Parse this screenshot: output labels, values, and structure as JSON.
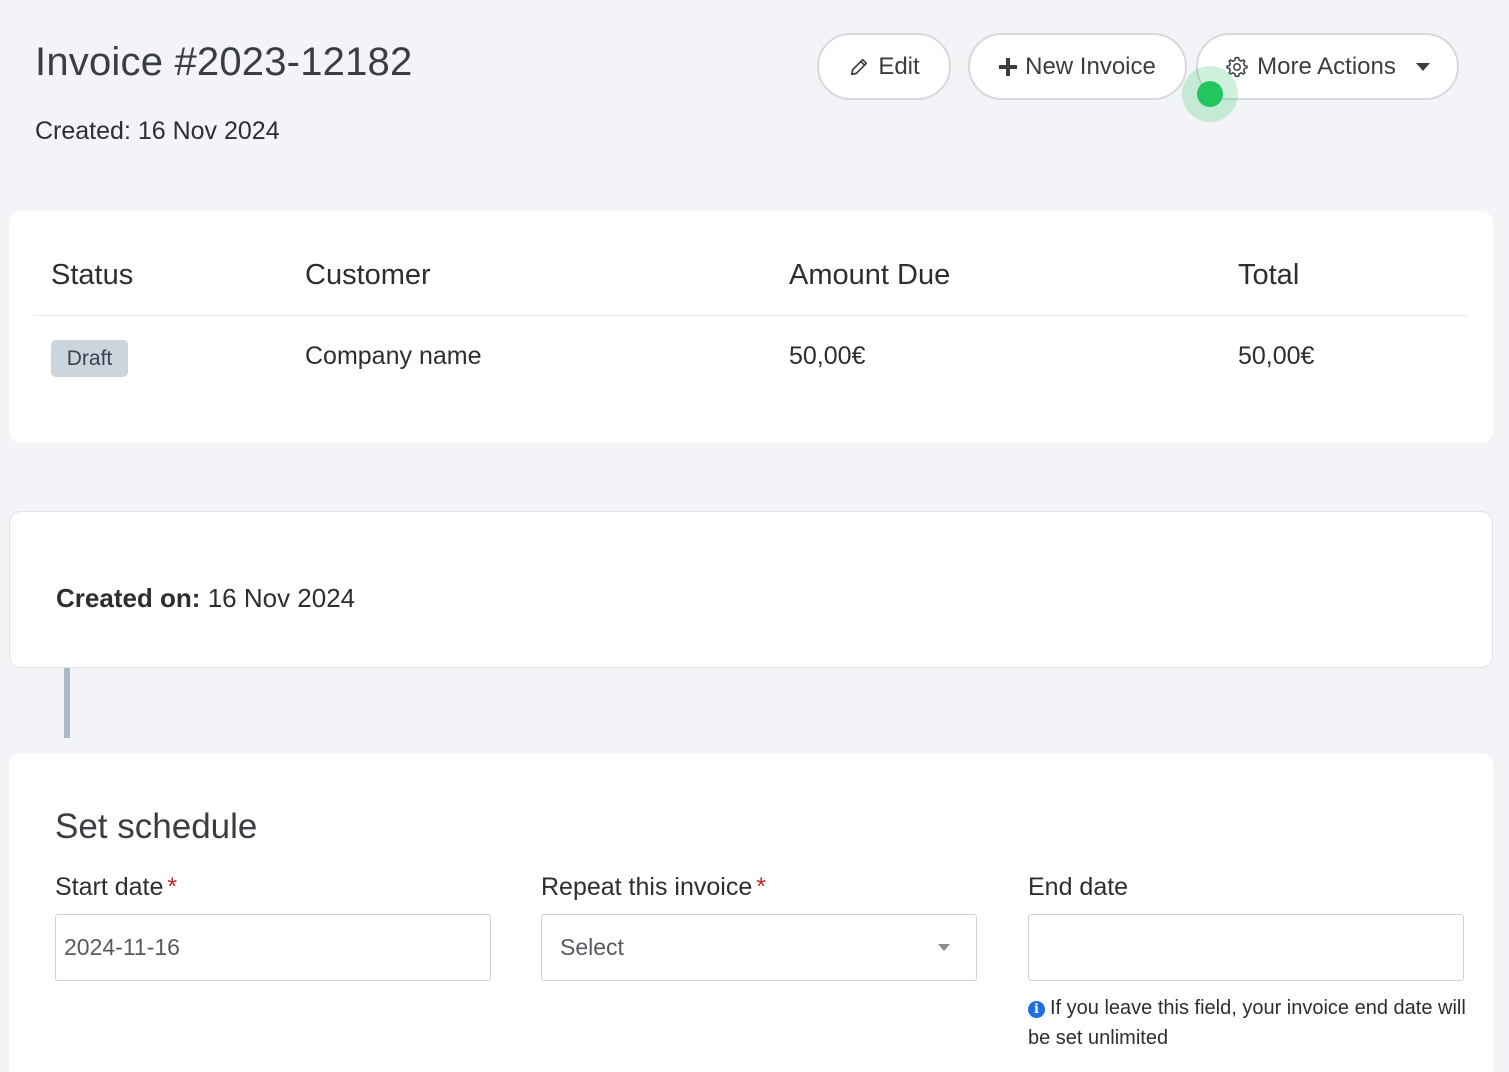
{
  "header": {
    "title": "Invoice #2023-12182",
    "created_label": "Created:",
    "created_value": "16 Nov 2024"
  },
  "toolbar": {
    "edit_label": "Edit",
    "new_invoice_label": "New Invoice",
    "more_actions_label": "More Actions"
  },
  "summary": {
    "columns": [
      "Status",
      "Customer",
      "Amount Due",
      "Total"
    ],
    "row": {
      "status": "Draft",
      "customer": "Company name",
      "amount_due": "50,00€",
      "total": "50,00€"
    }
  },
  "created_card": {
    "label": "Created on:",
    "value": "16 Nov 2024"
  },
  "schedule": {
    "title": "Set schedule",
    "start_date": {
      "label": "Start date",
      "required_mark": "*",
      "value": "2024-11-16"
    },
    "repeat": {
      "label": "Repeat this invoice",
      "required_mark": "*",
      "value": "Select"
    },
    "end_date": {
      "label": "End date",
      "value": "",
      "hint": "If you leave this field, your invoice end date will be set unlimited"
    }
  },
  "colors": {
    "background": "#f3f4f7",
    "badge_draft": "#cbd5de",
    "required": "#c0262d",
    "info_icon": "#1f6fe0",
    "cursor": "#22c55e"
  },
  "icons": {
    "edit": "pencil-icon",
    "new_invoice": "plus-icon",
    "more_actions": "gear-icon",
    "dropdown": "caret-down-icon",
    "hint": "info-icon"
  }
}
